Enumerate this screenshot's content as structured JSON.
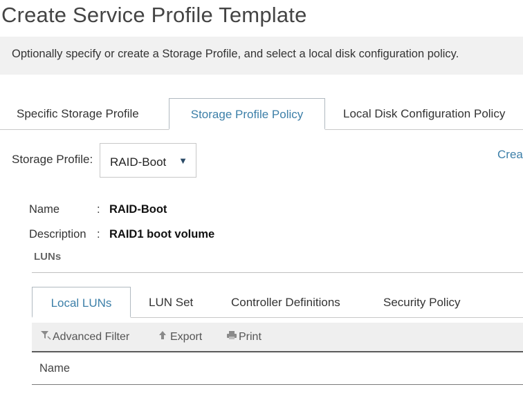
{
  "title": "Create Service Profile Template",
  "banner": "Optionally specify or create a Storage Profile, and select a local disk configuration policy.",
  "tabs": [
    {
      "label": "Specific Storage Profile"
    },
    {
      "label": "Storage Profile Policy"
    },
    {
      "label": "Local Disk Configuration Policy"
    }
  ],
  "storage_profile": {
    "label": "Storage Profile:",
    "selected": "RAID-Boot",
    "caret": "▼",
    "create_link": "Crea"
  },
  "details": {
    "name_key": "Name",
    "name_sep": ":",
    "name_value": "RAID-Boot",
    "desc_key": "Description",
    "desc_sep": ":",
    "desc_value": "RAID1 boot volume"
  },
  "luns": {
    "title": "LUNs",
    "tabs": [
      {
        "label": "Local LUNs"
      },
      {
        "label": "LUN Set"
      },
      {
        "label": "Controller Definitions"
      },
      {
        "label": "Security Policy"
      }
    ],
    "toolbar": {
      "filter": "Advanced Filter",
      "export": "Export",
      "print": "Print"
    },
    "columns": [
      "Name"
    ]
  },
  "icons": {
    "filter": "filter-icon",
    "export": "export-icon",
    "print": "print-icon"
  },
  "colors": {
    "accent": "#3c7fa8",
    "banner_bg": "#f1f1f1"
  }
}
